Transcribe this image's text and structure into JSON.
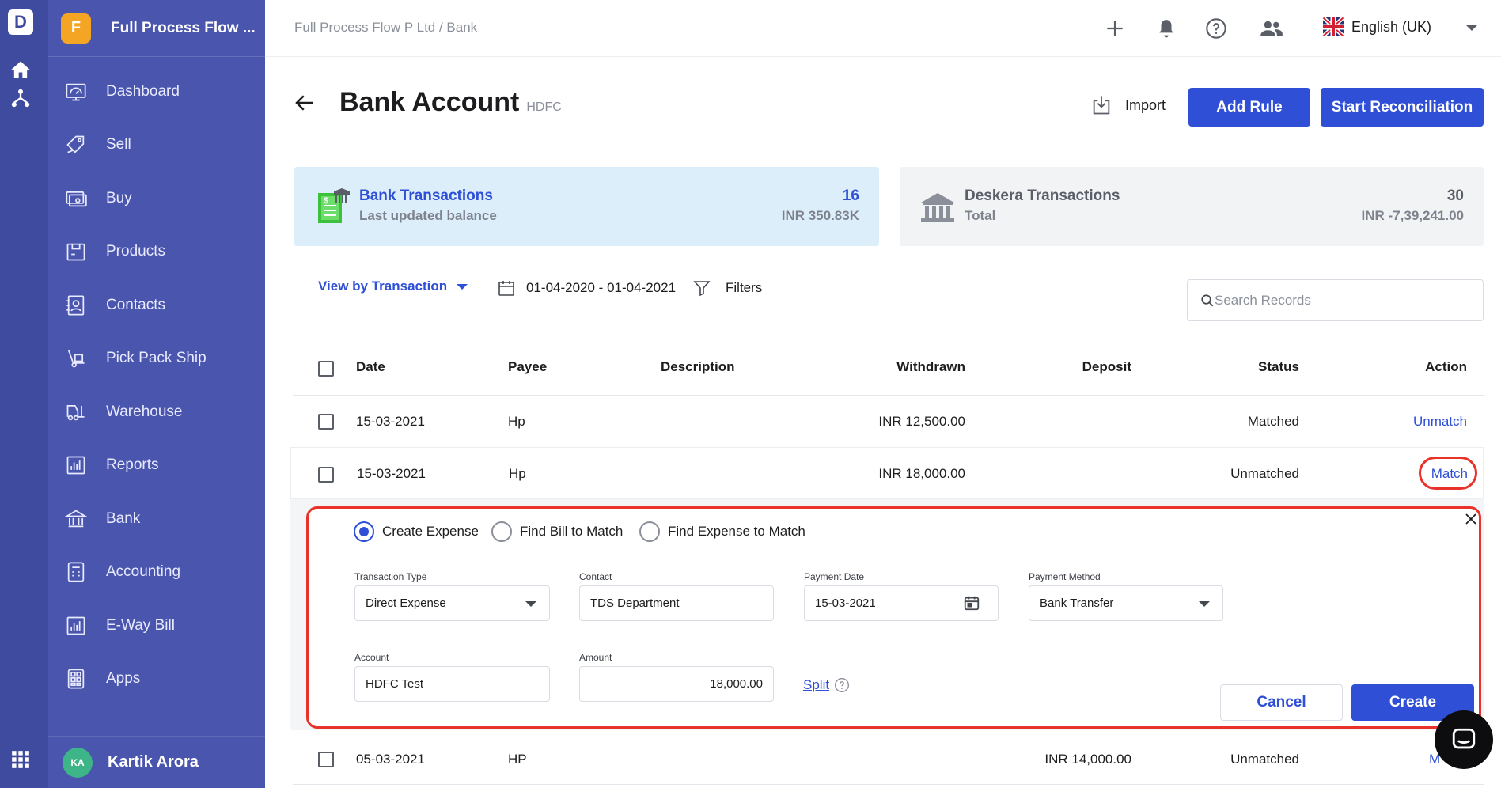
{
  "app": {
    "logo": "D"
  },
  "org": {
    "initial": "F",
    "name": "Full Process Flow ..."
  },
  "sidebar": {
    "items": [
      {
        "label": "Dashboard",
        "icon": "dashboard-icon"
      },
      {
        "label": "Sell",
        "icon": "sell-tag-icon"
      },
      {
        "label": "Buy",
        "icon": "buy-cash-icon"
      },
      {
        "label": "Products",
        "icon": "products-box-icon"
      },
      {
        "label": "Contacts",
        "icon": "contacts-book-icon"
      },
      {
        "label": "Pick Pack Ship",
        "icon": "hand-truck-icon"
      },
      {
        "label": "Warehouse",
        "icon": "forklift-icon"
      },
      {
        "label": "Reports",
        "icon": "bar-chart-icon"
      },
      {
        "label": "Bank",
        "icon": "bank-icon"
      },
      {
        "label": "Accounting",
        "icon": "calculator-icon"
      },
      {
        "label": "E-Way Bill",
        "icon": "bar-chart-icon"
      },
      {
        "label": "Apps",
        "icon": "apps-grid-icon"
      }
    ],
    "user": {
      "initials": "KA",
      "name": "Kartik Arora"
    }
  },
  "header": {
    "breadcrumb": "Full Process Flow P Ltd / Bank",
    "language": "English (UK)"
  },
  "page": {
    "title": "Bank Account",
    "subtitle": "HDFC",
    "import_label": "Import",
    "add_rule_label": "Add Rule",
    "start_reconciliation_label": "Start Reconciliation"
  },
  "cards": {
    "bank": {
      "title": "Bank Transactions",
      "subtitle": "Last updated balance",
      "count": "16",
      "amount": "INR 350.83K"
    },
    "deskera": {
      "title": "Deskera Transactions",
      "subtitle": "Total",
      "count": "30",
      "amount": "INR -7,39,241.00"
    }
  },
  "toolbar": {
    "view_label": "View by Transaction",
    "date_range": "01-04-2020 - 01-04-2021",
    "filters_label": "Filters",
    "search_placeholder": "Search Records"
  },
  "table": {
    "columns": {
      "date": "Date",
      "payee": "Payee",
      "description": "Description",
      "withdrawn": "Withdrawn",
      "deposit": "Deposit",
      "status": "Status",
      "action": "Action"
    },
    "rows": [
      {
        "date": "15-03-2021",
        "payee": "Hp",
        "withdrawn": "INR 12,500.00",
        "deposit": "",
        "status": "Matched",
        "action": "Unmatch"
      },
      {
        "date": "15-03-2021",
        "payee": "Hp",
        "withdrawn": "INR 18,000.00",
        "deposit": "",
        "status": "Unmatched",
        "action": "Match"
      },
      {
        "date": "05-03-2021",
        "payee": "HP",
        "withdrawn": "",
        "deposit": "INR 14,000.00",
        "status": "Unmatched",
        "action": "M"
      }
    ]
  },
  "match_panel": {
    "options": [
      "Create Expense",
      "Find Bill to Match",
      "Find Expense to Match"
    ],
    "selected_option": "Create Expense",
    "transaction_type": {
      "label": "Transaction Type",
      "value": "Direct Expense"
    },
    "contact": {
      "label": "Contact",
      "value": "TDS Department"
    },
    "payment_date": {
      "label": "Payment Date",
      "value": "15-03-2021"
    },
    "payment_method": {
      "label": "Payment Method",
      "value": "Bank Transfer"
    },
    "account": {
      "label": "Account",
      "value": "HDFC Test"
    },
    "amount": {
      "label": "Amount",
      "value": "18,000.00"
    },
    "split_label": "Split",
    "cancel_label": "Cancel",
    "create_label": "Create"
  },
  "colors": {
    "primary": "#2e4fd6",
    "sidebar": "#4a55ad",
    "rail": "#3f4b9e",
    "highlight": "#e8322a",
    "bank_card": "#ddeefb",
    "deskera_card": "#f2f3f5"
  }
}
